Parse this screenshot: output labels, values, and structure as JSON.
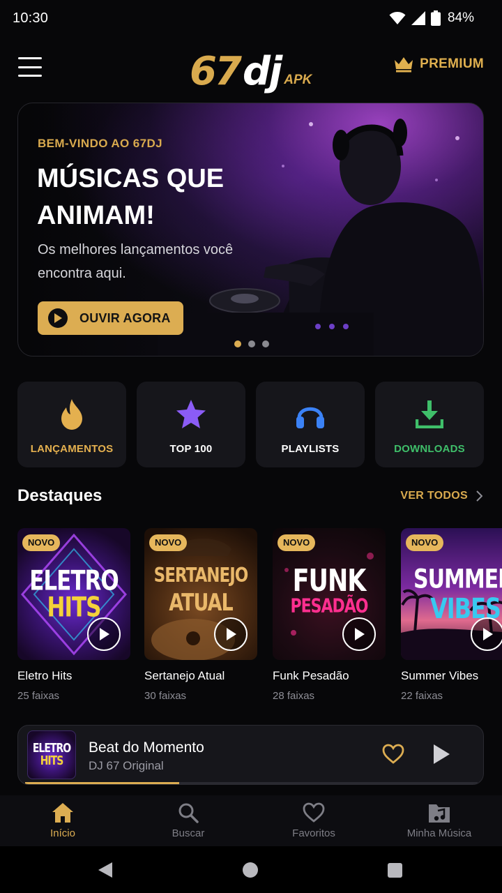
{
  "status_bar": {
    "time": "10:30",
    "battery": "84%"
  },
  "header": {
    "logo_number": "67",
    "logo_dj": "dj",
    "logo_apk": "APK",
    "premium_label": "PREMIUM",
    "accent_color": "#dcad52"
  },
  "hero": {
    "kicker": "BEM-VINDO AO 67DJ",
    "title": "MÚSICAS QUE ANIMAM!",
    "subtitle": "Os melhores lançamentos você encontra aqui.",
    "cta_label": "OUVIR AGORA",
    "slides_count": 3,
    "active_slide": 1
  },
  "categories": [
    {
      "label": "LANÇAMENTOS",
      "icon": "fire-icon",
      "color": "#e4b04f"
    },
    {
      "label": "TOP 100",
      "icon": "star-icon",
      "color": "#8b5cf6"
    },
    {
      "label": "PLAYLISTS",
      "icon": "headphones-icon",
      "color": "#3b82f6"
    },
    {
      "label": "DOWNLOADS",
      "icon": "download-icon",
      "color": "#3fbf6a"
    }
  ],
  "featured": {
    "title": "Destaques",
    "see_all": "VER TODOS",
    "items": [
      {
        "badge": "NOVO",
        "art_line1": "ELETRO",
        "art_line2": "HITS",
        "title": "Eletro Hits",
        "tracks": "25 faixas"
      },
      {
        "badge": "NOVO",
        "art_line1": "SERTANEJO",
        "art_line2": "ATUAL",
        "title": "Sertanejo Atual",
        "tracks": "30 faixas"
      },
      {
        "badge": "NOVO",
        "art_line1": "FUNK",
        "art_line2": "PESADÃO",
        "title": "Funk Pesadão",
        "tracks": "28 faixas"
      },
      {
        "badge": "NOVO",
        "art_line1": "SUMMER",
        "art_line2": "VIBES",
        "title": "Summer Vibes",
        "tracks": "22 faixas"
      }
    ]
  },
  "mini_player": {
    "thumb_line1": "ELETRO",
    "thumb_line2": "HITS",
    "title": "Beat do Momento",
    "artist": "DJ 67 Original",
    "progress": 0.34
  },
  "bottom_nav": [
    {
      "label": "Início",
      "icon": "home-icon",
      "active": true
    },
    {
      "label": "Buscar",
      "icon": "search-icon",
      "active": false
    },
    {
      "label": "Favoritos",
      "icon": "heart-icon",
      "active": false
    },
    {
      "label": "Minha Música",
      "icon": "music-folder-icon",
      "active": false
    }
  ]
}
